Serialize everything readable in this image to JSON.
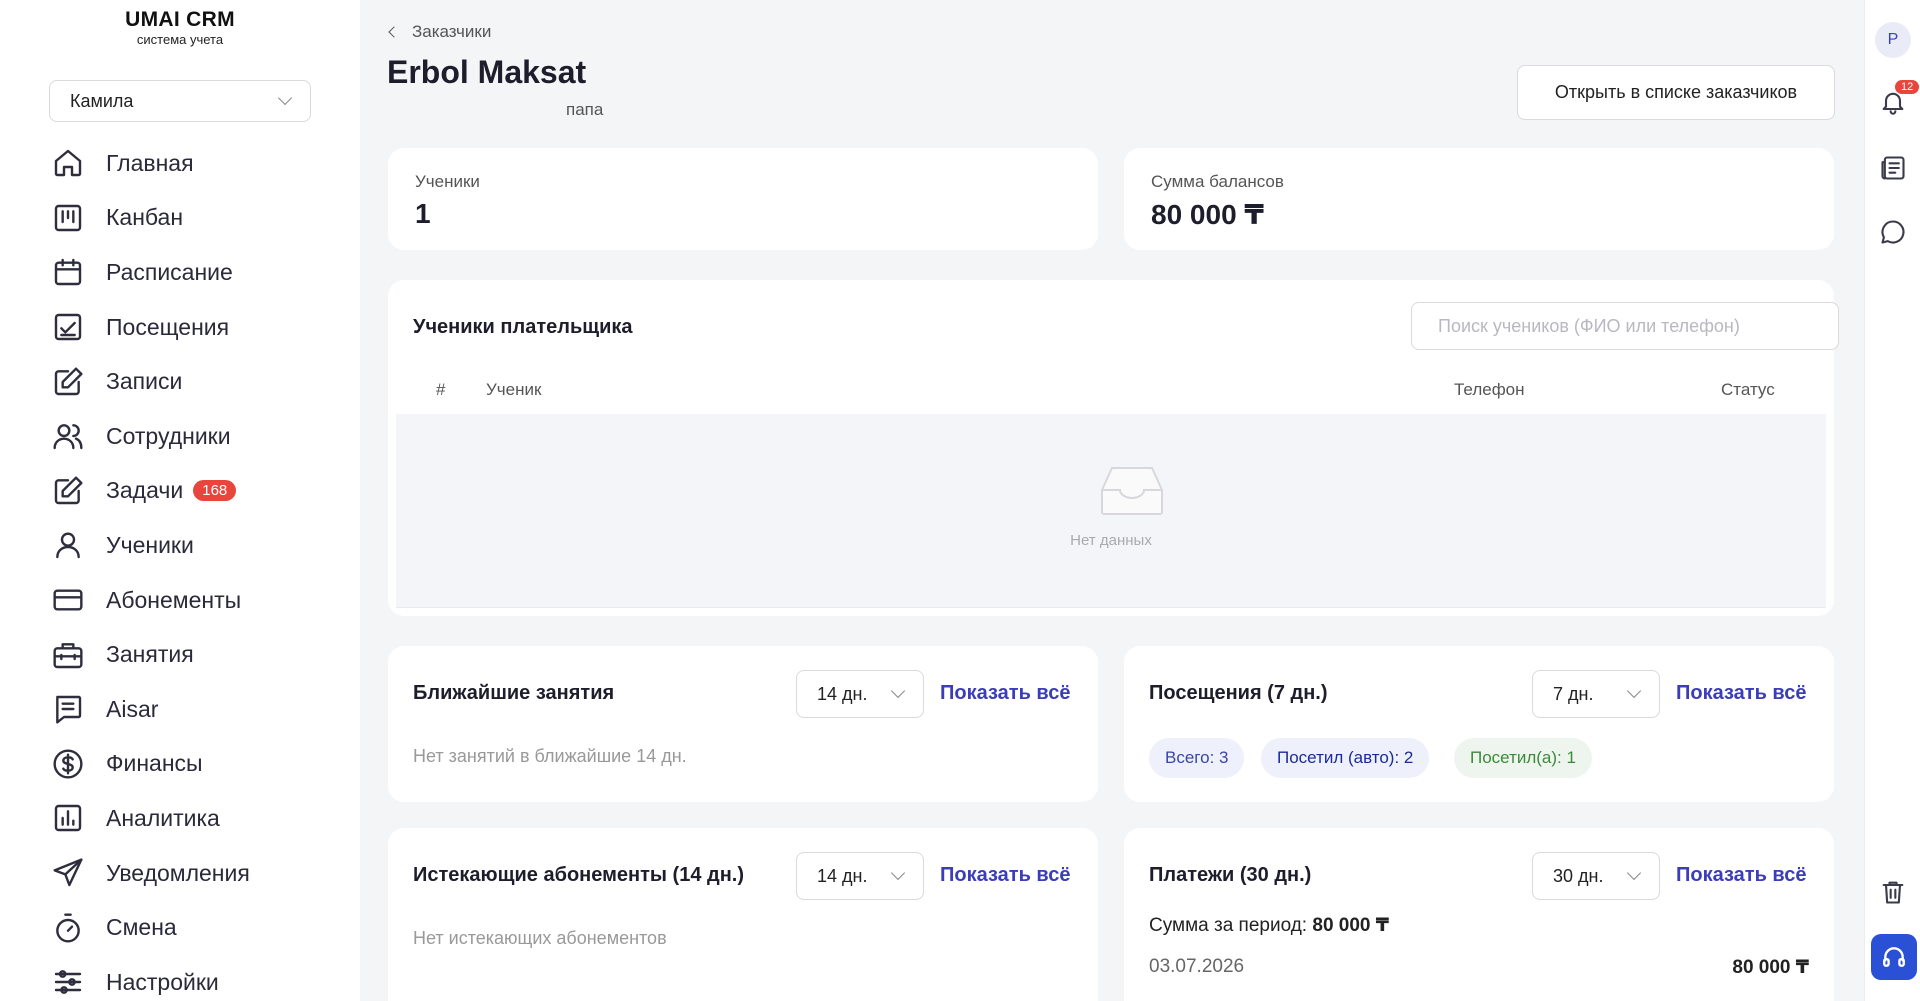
{
  "brand": {
    "title": "UMAI CRM",
    "subtitle": "система учета"
  },
  "user_select": {
    "value": "Камила"
  },
  "nav": [
    {
      "label": "Главная",
      "icon": "home-icon"
    },
    {
      "label": "Канбан",
      "icon": "kanban-icon"
    },
    {
      "label": "Расписание",
      "icon": "calendar-icon"
    },
    {
      "label": "Посещения",
      "icon": "attendance-icon"
    },
    {
      "label": "Записи",
      "icon": "edit-icon"
    },
    {
      "label": "Сотрудники",
      "icon": "users-icon"
    },
    {
      "label": "Задачи",
      "icon": "edit-icon",
      "badge": "168"
    },
    {
      "label": "Ученики",
      "icon": "user-icon"
    },
    {
      "label": "Абонементы",
      "icon": "card-icon"
    },
    {
      "label": "Занятия",
      "icon": "briefcase-icon"
    },
    {
      "label": "Aisar",
      "icon": "chat-list-icon"
    },
    {
      "label": "Финансы",
      "icon": "dollar-icon"
    },
    {
      "label": "Аналитика",
      "icon": "analytics-icon"
    },
    {
      "label": "Уведомления",
      "icon": "send-icon"
    },
    {
      "label": "Смена",
      "icon": "timer-icon"
    },
    {
      "label": "Настройки",
      "icon": "sliders-icon"
    }
  ],
  "rail": {
    "avatar": "P",
    "notifications_count": "12"
  },
  "header": {
    "breadcrumb": "Заказчики",
    "title": "Erbol Maksat",
    "relation": "папа",
    "open_button": "Открыть в списке заказчиков"
  },
  "stats": {
    "students": {
      "label": "Ученики",
      "value": "1"
    },
    "balance": {
      "label": "Сумма балансов",
      "value": "80 000 ₸"
    }
  },
  "payer_students": {
    "title": "Ученики плательщика",
    "search_placeholder": "Поиск учеников (ФИО или телефон)",
    "columns": [
      "#",
      "Ученик",
      "Телефон",
      "Статус"
    ],
    "empty_text": "Нет данных"
  },
  "upcoming": {
    "title": "Ближайшие занятия",
    "period": "14 дн.",
    "show_all": "Показать всё",
    "empty_text": "Нет занятий в ближайшие 14 дн."
  },
  "attendance": {
    "title": "Посещения (7 дн.)",
    "period": "7 дн.",
    "show_all": "Показать всё",
    "chips": [
      "Всего: 3",
      "Посетил (авто): 2",
      "Посетил(а): 1"
    ]
  },
  "expiring": {
    "title": "Истекающие абонементы (14 дн.)",
    "period": "14 дн.",
    "show_all": "Показать всё",
    "empty_text": "Нет истекающих абонементов"
  },
  "payments": {
    "title": "Платежи (30 дн.)",
    "period": "30 дн.",
    "show_all": "Показать всё",
    "sum_label": "Сумма за период:",
    "sum_value": "80 000 ₸",
    "rows": [
      {
        "date": "03.07.2026",
        "amount": "80 000 ₸"
      }
    ]
  }
}
